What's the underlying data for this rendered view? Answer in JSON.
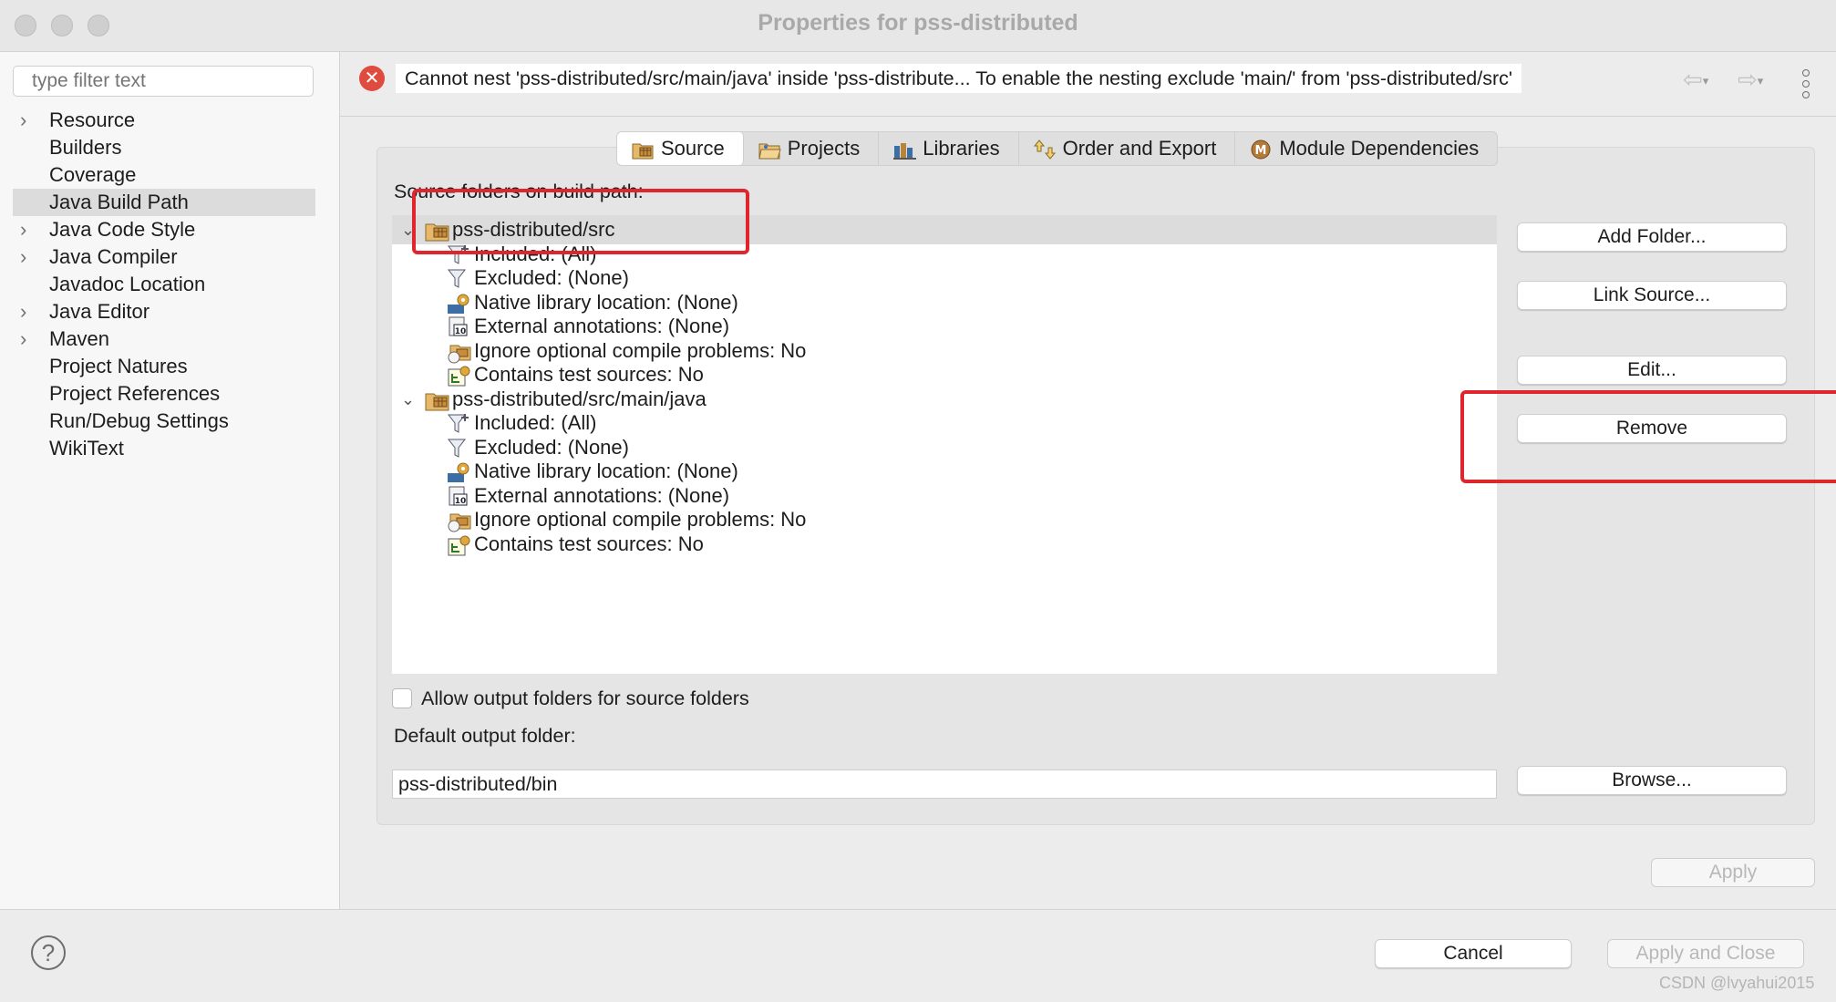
{
  "window": {
    "title": "Properties for pss-distributed"
  },
  "sidebar": {
    "filter_placeholder": "type filter text",
    "items": [
      {
        "label": "Resource",
        "expandable": true
      },
      {
        "label": "Builders",
        "expandable": false
      },
      {
        "label": "Coverage",
        "expandable": false
      },
      {
        "label": "Java Build Path",
        "expandable": false,
        "selected": true
      },
      {
        "label": "Java Code Style",
        "expandable": true
      },
      {
        "label": "Java Compiler",
        "expandable": true
      },
      {
        "label": "Javadoc Location",
        "expandable": false
      },
      {
        "label": "Java Editor",
        "expandable": true
      },
      {
        "label": "Maven",
        "expandable": true
      },
      {
        "label": "Project Natures",
        "expandable": false
      },
      {
        "label": "Project References",
        "expandable": false
      },
      {
        "label": "Run/Debug Settings",
        "expandable": false
      },
      {
        "label": "WikiText",
        "expandable": false
      }
    ]
  },
  "message": {
    "text": "Cannot nest 'pss-distributed/src/main/java' inside 'pss-distribute... To enable the nesting exclude 'main/' from 'pss-distributed/src'"
  },
  "tabs": [
    {
      "label": "Source",
      "active": true
    },
    {
      "label": "Projects"
    },
    {
      "label": "Libraries"
    },
    {
      "label": "Order and Export"
    },
    {
      "label": "Module Dependencies"
    }
  ],
  "source": {
    "label": "Source folders on build path:",
    "folders": [
      {
        "name": "pss-distributed/src",
        "selected": true,
        "children": [
          {
            "icon": "filter-included-icon",
            "text": "Included: (All)"
          },
          {
            "icon": "filter-excluded-icon",
            "text": "Excluded: (None)"
          },
          {
            "icon": "native-library-icon",
            "text": "Native library location: (None)"
          },
          {
            "icon": "external-annotations-icon",
            "text": "External annotations: (None)"
          },
          {
            "icon": "ignore-problems-icon",
            "text": "Ignore optional compile problems: No"
          },
          {
            "icon": "test-sources-icon",
            "text": "Contains test sources: No"
          }
        ]
      },
      {
        "name": "pss-distributed/src/main/java",
        "selected": false,
        "children": [
          {
            "icon": "filter-included-icon",
            "text": "Included: (All)"
          },
          {
            "icon": "filter-excluded-icon",
            "text": "Excluded: (None)"
          },
          {
            "icon": "native-library-icon",
            "text": "Native library location: (None)"
          },
          {
            "icon": "external-annotations-icon",
            "text": "External annotations: (None)"
          },
          {
            "icon": "ignore-problems-icon",
            "text": "Ignore optional compile problems: No"
          },
          {
            "icon": "test-sources-icon",
            "text": "Contains test sources: No"
          }
        ]
      }
    ],
    "buttons": {
      "add_folder": "Add Folder...",
      "link_source": "Link Source...",
      "edit": "Edit...",
      "remove": "Remove",
      "browse": "Browse..."
    },
    "allow_output": {
      "label": "Allow output folders for source folders",
      "checked": false
    },
    "default_output": {
      "label": "Default output folder:",
      "value": "pss-distributed/bin"
    }
  },
  "footer": {
    "apply": "Apply",
    "cancel": "Cancel",
    "apply_close": "Apply and Close",
    "help": "?"
  },
  "watermark": "CSDN @lvyahui2015",
  "colors": {
    "error": "#e04b3f",
    "highlight_box": "#e0262d",
    "selection": "#dcdcdc"
  }
}
